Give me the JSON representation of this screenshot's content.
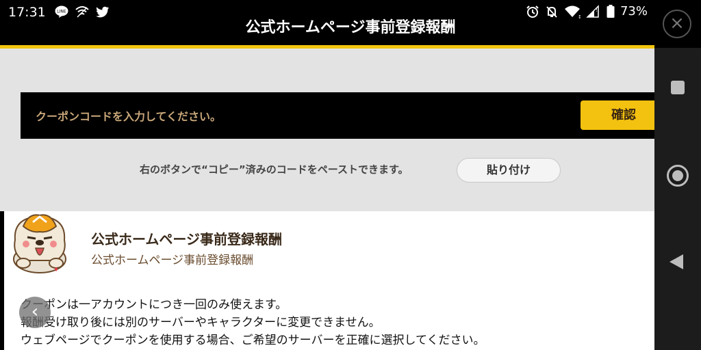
{
  "status_bar": {
    "time": "17:31",
    "left_icons": [
      "line-icon",
      "wifi-off-icon",
      "twitter-icon"
    ],
    "right_icons": [
      "alarm-icon",
      "notifications-off-icon",
      "wifi-icon",
      "signal-icon",
      "battery-icon"
    ],
    "battery_text": "73%"
  },
  "header": {
    "title": "公式ホームページ事前登録報酬",
    "close_symbol": "×",
    "accent_color": "#f1c40f"
  },
  "coupon": {
    "input_placeholder": "クーポンコードを入力してください。",
    "confirm_label": "確認",
    "paste_hint": "右のボタンで“コピー”済みのコードをペーストできます。",
    "paste_label": "貼り付け",
    "button_color": "#f3c10f"
  },
  "reward": {
    "mascot_icon": "dog-mascot-icon",
    "title": "公式ホームページ事前登録報酬",
    "subtitle": "公式ホームページ事前登録報酬",
    "notes": [
      "クーポンは一アカウントにつき一回のみ使えます。",
      "報酬受け取り後には別のサーバーやキャラクターに変更できません。",
      "ウェブページでクーポンを使用する場合、ご希望のサーバーを正確に選択してください。"
    ],
    "back_symbol": "‹"
  },
  "nav_bar": {
    "recent_icon": "square-recent-icon",
    "home_icon": "circle-home-icon",
    "back_icon": "triangle-back-icon"
  }
}
